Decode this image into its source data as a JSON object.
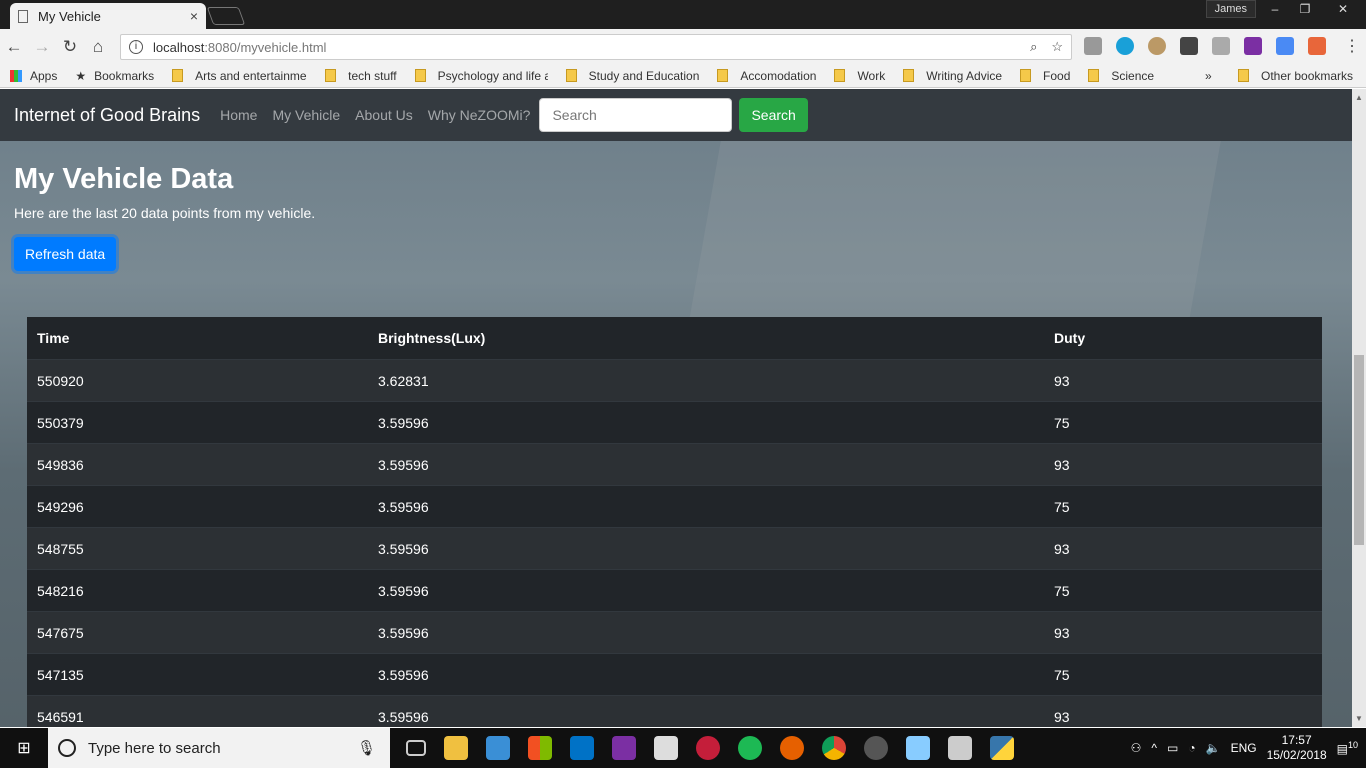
{
  "browser": {
    "tab_title": "My Vehicle",
    "tab_close": "×",
    "user": "James",
    "url_host": "localhost",
    "url_rest": ":8080/myvehicle.html",
    "bookmarks": [
      {
        "label": "Apps"
      },
      {
        "label": "Bookmarks"
      },
      {
        "label": "Arts and entertainme"
      },
      {
        "label": "tech stuff"
      },
      {
        "label": "Psychology and life a"
      },
      {
        "label": "Study and Education"
      },
      {
        "label": "Accomodation"
      },
      {
        "label": "Work"
      },
      {
        "label": "Writing Advice"
      },
      {
        "label": "Food"
      },
      {
        "label": "Science"
      }
    ],
    "more": "»",
    "other_bookmarks": "Other bookmarks"
  },
  "navbar": {
    "brand": "Internet of Good Brains",
    "links": [
      "Home",
      "My Vehicle",
      "About Us",
      "Why NeZOOMi?"
    ],
    "search_placeholder": "Search",
    "search_button": "Search"
  },
  "main": {
    "title": "My Vehicle Data",
    "lead": "Here are the last 20 data points from my vehicle.",
    "refresh_button": "Refresh data"
  },
  "table": {
    "headers": [
      "Time",
      "Brightness(Lux)",
      "Duty"
    ],
    "rows": [
      [
        "550920",
        "3.62831",
        "93"
      ],
      [
        "550379",
        "3.59596",
        "75"
      ],
      [
        "549836",
        "3.59596",
        "93"
      ],
      [
        "549296",
        "3.59596",
        "75"
      ],
      [
        "548755",
        "3.59596",
        "93"
      ],
      [
        "548216",
        "3.59596",
        "75"
      ],
      [
        "547675",
        "3.59596",
        "93"
      ],
      [
        "547135",
        "3.59596",
        "75"
      ],
      [
        "546591",
        "3.59596",
        "93"
      ]
    ]
  },
  "taskbar": {
    "search_text": "Type here to search",
    "lang": "ENG",
    "time": "17:57",
    "date": "15/02/2018",
    "notifications": "10"
  },
  "colors": {
    "navbar_bg": "#343a40",
    "search_btn": "#28a745",
    "refresh_btn": "#007bff",
    "table_bg": "#212529"
  }
}
